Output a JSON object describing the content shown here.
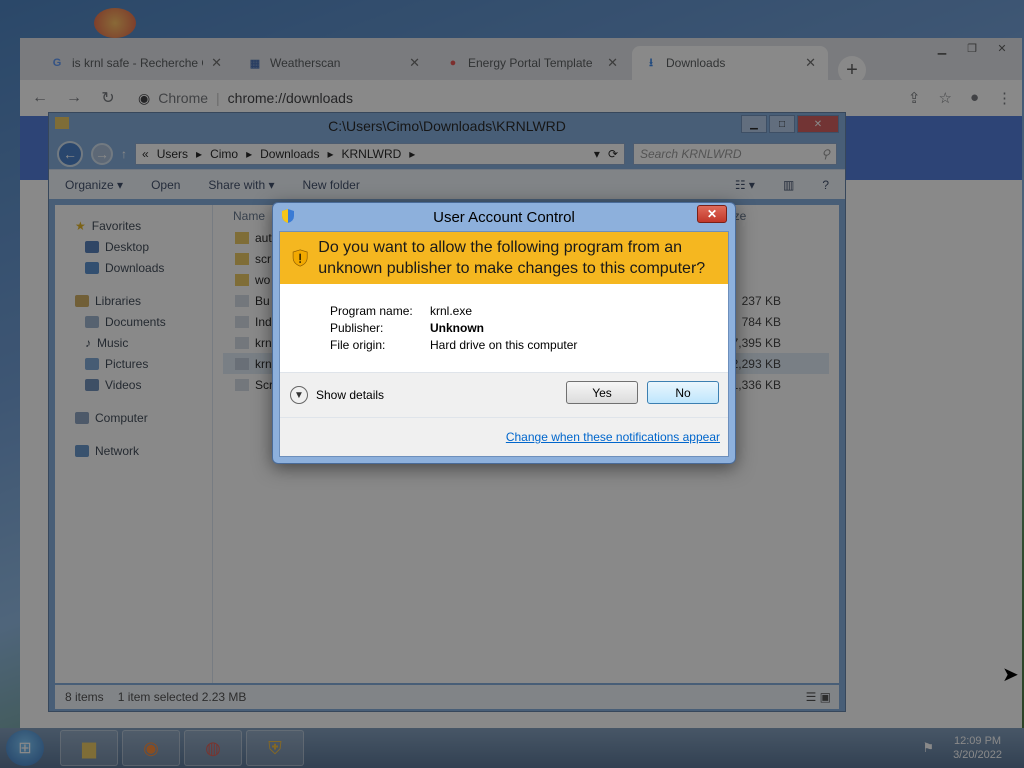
{
  "chrome": {
    "tabs": [
      {
        "icon": "G",
        "title": "is krnl safe - Recherche G"
      },
      {
        "icon": "▦",
        "title": "Weatherscan"
      },
      {
        "icon": "●",
        "title": "Energy Portal Template"
      },
      {
        "icon": "⭳",
        "title": "Downloads"
      }
    ],
    "omnibox_chip": "Chrome",
    "url": "chrome://downloads"
  },
  "explorer": {
    "title": "C:\\Users\\Cimo\\Downloads\\KRNLWRD",
    "breadcrumb": [
      "Users",
      "Cimo",
      "Downloads",
      "KRNLWRD"
    ],
    "search_placeholder": "Search KRNLWRD",
    "commands": [
      "Organize ▾",
      "Open",
      "Share with ▾",
      "New folder"
    ],
    "nav": {
      "favorites": "Favorites",
      "desktop": "Desktop",
      "downloads": "Downloads",
      "libraries": "Libraries",
      "documents": "Documents",
      "music": "Music",
      "pictures": "Pictures",
      "videos": "Videos",
      "computer": "Computer",
      "network": "Network"
    },
    "column_name": "Name",
    "column_size": "Size",
    "files": [
      {
        "name": "aut",
        "size": ""
      },
      {
        "name": "scr",
        "size": ""
      },
      {
        "name": "wo",
        "size": ""
      },
      {
        "name": "Bu",
        "size": "237 KB"
      },
      {
        "name": "Ind",
        "size": "784 KB"
      },
      {
        "name": "krn",
        "size": "7,395 KB"
      },
      {
        "name": "krn",
        "size": "2,293 KB"
      },
      {
        "name": "Scr",
        "size": "1,336 KB"
      }
    ],
    "status_items": "8 items",
    "status_selected": "1 item selected  2.23 MB"
  },
  "uac": {
    "title": "User Account Control",
    "question": "Do you want to allow the following program from an unknown publisher to make changes to this computer?",
    "program_name_label": "Program name:",
    "program_name": "krnl.exe",
    "publisher_label": "Publisher:",
    "publisher": "Unknown",
    "file_origin_label": "File origin:",
    "file_origin": "Hard drive on this computer",
    "show_details": "Show details",
    "yes": "Yes",
    "no": "No",
    "change_link": "Change when these notifications appear"
  },
  "taskbar": {
    "time": "12:09 PM",
    "date": "3/20/2022"
  }
}
